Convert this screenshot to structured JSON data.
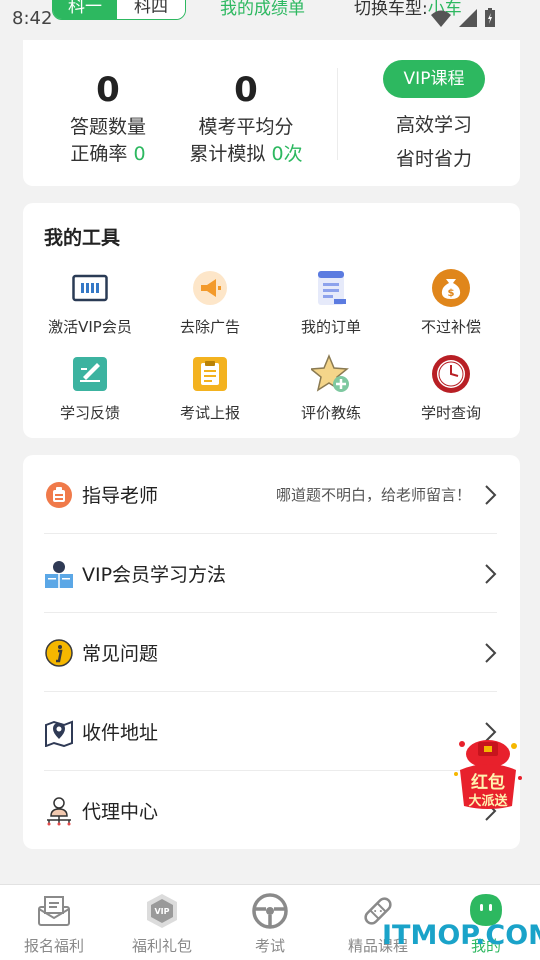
{
  "status_bar": {
    "time": "8:42"
  },
  "header": {
    "subject_tabs": [
      "科一",
      "科四"
    ],
    "score_link": "我的成绩单",
    "car_switch_label": "切换车型:",
    "car_switch_value": "小车"
  },
  "stats": {
    "answered_count": "0",
    "answered_label": "答题数量",
    "accuracy_label": "正确率",
    "accuracy_value": "0",
    "mock_avg": "0",
    "mock_avg_label": "模考平均分",
    "mock_total_label": "累计模拟",
    "mock_total_value": "0次",
    "vip_button": "VIP课程",
    "vip_line1": "高效学习",
    "vip_line2": "省时省力"
  },
  "tools": {
    "title": "我的工具",
    "items": [
      {
        "label": "激活VIP会员",
        "icon": "vip-card-icon"
      },
      {
        "label": "去除广告",
        "icon": "megaphone-icon"
      },
      {
        "label": "我的订单",
        "icon": "order-list-icon"
      },
      {
        "label": "不过补偿",
        "icon": "money-bag-icon"
      },
      {
        "label": "学习反馈",
        "icon": "feedback-pen-icon"
      },
      {
        "label": "考试上报",
        "icon": "report-clipboard-icon"
      },
      {
        "label": "评价教练",
        "icon": "star-plus-icon"
      },
      {
        "label": "学时查询",
        "icon": "clock-icon"
      }
    ]
  },
  "menu": {
    "items": [
      {
        "label": "指导老师",
        "hint": "哪道题不明白，给老师留言！",
        "icon": "teacher-badge-icon"
      },
      {
        "label": "VIP会员学习方法",
        "hint": "",
        "icon": "reader-icon"
      },
      {
        "label": "常见问题",
        "hint": "",
        "icon": "info-icon"
      },
      {
        "label": "收件地址",
        "hint": "",
        "icon": "map-pin-icon"
      },
      {
        "label": "代理中心",
        "hint": "",
        "icon": "agent-icon"
      }
    ]
  },
  "promo": {
    "line1": "红包",
    "line2": "大派送"
  },
  "tabbar": {
    "items": [
      {
        "label": "报名福利",
        "icon": "envelope-icon"
      },
      {
        "label": "福利礼包",
        "icon": "vip-hex-icon"
      },
      {
        "label": "考试",
        "icon": "steering-wheel-icon"
      },
      {
        "label": "精品课程",
        "icon": "bandage-icon"
      },
      {
        "label": "我的",
        "icon": "face-icon"
      }
    ]
  },
  "watermark": "ITMOP.COM",
  "colors": {
    "accent": "#2db860",
    "text": "#222222",
    "muted": "#8a8a8a"
  }
}
